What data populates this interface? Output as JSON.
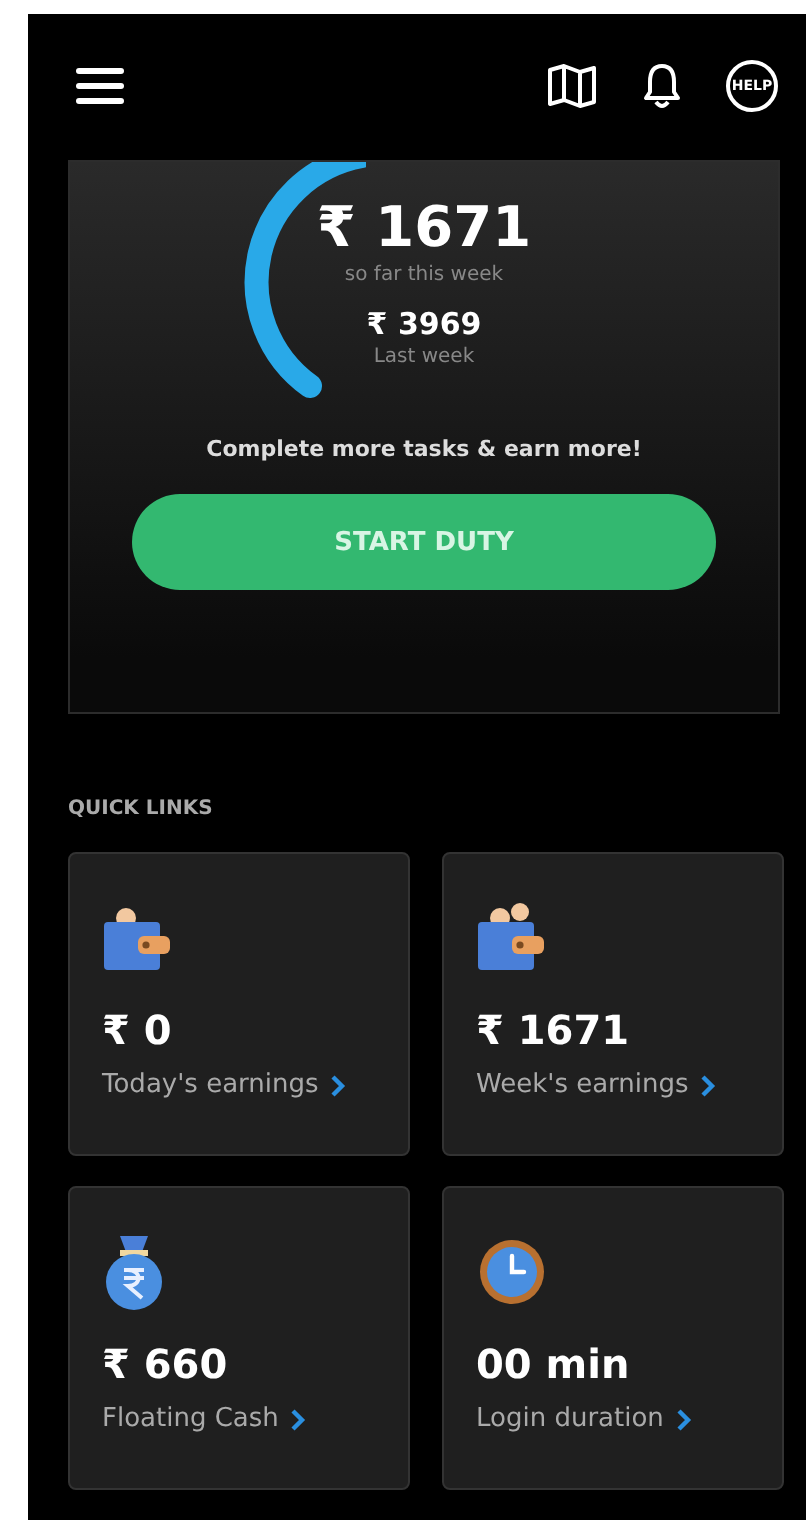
{
  "header": {
    "help_label": "HELP"
  },
  "hero": {
    "amount": "₹ 1671",
    "caption": "so far this week",
    "last_amount": "₹ 3969",
    "last_caption": "Last week",
    "prompt": "Complete more tasks & earn more!",
    "button": "START DUTY"
  },
  "quick_links": {
    "title": "QUICK LINKS",
    "cards": [
      {
        "kind": "wallet",
        "value": "₹ 0",
        "label": "Today's earnings"
      },
      {
        "kind": "wallet-coins",
        "value": "₹ 1671",
        "label": "Week's earnings"
      },
      {
        "kind": "bag",
        "value": "₹ 660",
        "label": "Floating Cash"
      },
      {
        "kind": "clock",
        "value": "00 min",
        "label": "Login duration"
      }
    ]
  }
}
